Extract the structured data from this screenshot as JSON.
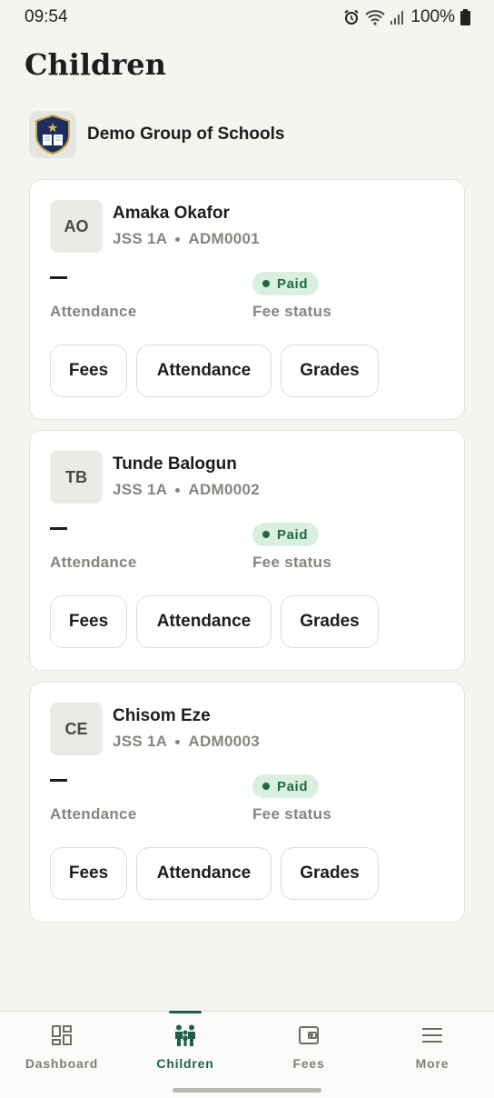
{
  "status_bar": {
    "time": "09:54",
    "battery": "100%",
    "icons": [
      "alarm-icon",
      "wifi-icon",
      "signal-icon",
      "battery-icon"
    ]
  },
  "page": {
    "title": "Children"
  },
  "school": {
    "name": "Demo Group of Schools",
    "logo_icon": "school-crest-icon"
  },
  "children": [
    {
      "initials": "AO",
      "name": "Amaka Okafor",
      "class": "JSS 1A",
      "admission": "ADM0001",
      "attendance_value": "—",
      "attendance_label": "Attendance",
      "fee_status": "Paid",
      "fee_label": "Fee status",
      "buttons": {
        "fees": "Fees",
        "attendance": "Attendance",
        "grades": "Grades"
      }
    },
    {
      "initials": "TB",
      "name": "Tunde Balogun",
      "class": "JSS 1A",
      "admission": "ADM0002",
      "attendance_value": "—",
      "attendance_label": "Attendance",
      "fee_status": "Paid",
      "fee_label": "Fee status",
      "buttons": {
        "fees": "Fees",
        "attendance": "Attendance",
        "grades": "Grades"
      }
    },
    {
      "initials": "CE",
      "name": "Chisom Eze",
      "class": "JSS 1A",
      "admission": "ADM0003",
      "attendance_value": "—",
      "attendance_label": "Attendance",
      "fee_status": "Paid",
      "fee_label": "Fee status",
      "buttons": {
        "fees": "Fees",
        "attendance": "Attendance",
        "grades": "Grades"
      }
    }
  ],
  "nav": {
    "items": [
      {
        "label": "Dashboard",
        "icon": "dashboard-icon",
        "active": false
      },
      {
        "label": "Children",
        "icon": "children-icon",
        "active": true
      },
      {
        "label": "Fees",
        "icon": "wallet-icon",
        "active": false
      },
      {
        "label": "More",
        "icon": "menu-icon",
        "active": false
      }
    ]
  },
  "colors": {
    "background": "#f4f4f1",
    "accent": "#1f5e4b",
    "paid_badge_bg": "#d9efe0",
    "paid_badge_text": "#1f6b3f",
    "muted_text": "#85857f"
  }
}
